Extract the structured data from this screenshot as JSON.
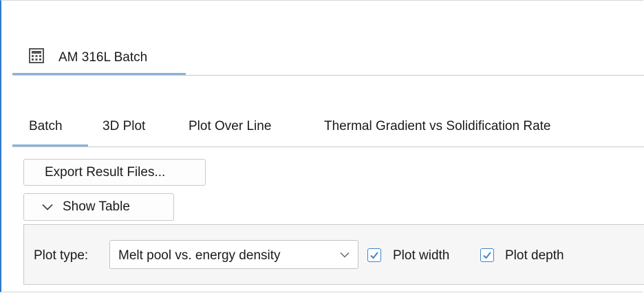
{
  "window_tab": {
    "icon": "calculator-icon",
    "title": "AM 316L Batch"
  },
  "sub_tabs": [
    {
      "label": "Batch",
      "active": true
    },
    {
      "label": "3D Plot",
      "active": false
    },
    {
      "label": "Plot Over Line",
      "active": false
    },
    {
      "label": "Thermal Gradient vs Solidification Rate",
      "active": false
    }
  ],
  "buttons": {
    "export_label": "Export Result Files...",
    "show_table_label": "Show Table",
    "show_table_icon": "chevron-down-icon"
  },
  "plot_options": {
    "plot_type_label": "Plot type:",
    "plot_type_value": "Melt pool vs. energy density",
    "plot_width": {
      "label": "Plot width",
      "checked": true
    },
    "plot_depth": {
      "label": "Plot depth",
      "checked": true
    }
  },
  "colors": {
    "accent": "#2e78c7",
    "tab_underline": "#8ab3d9",
    "checkbox_accent": "#3d85d0"
  }
}
